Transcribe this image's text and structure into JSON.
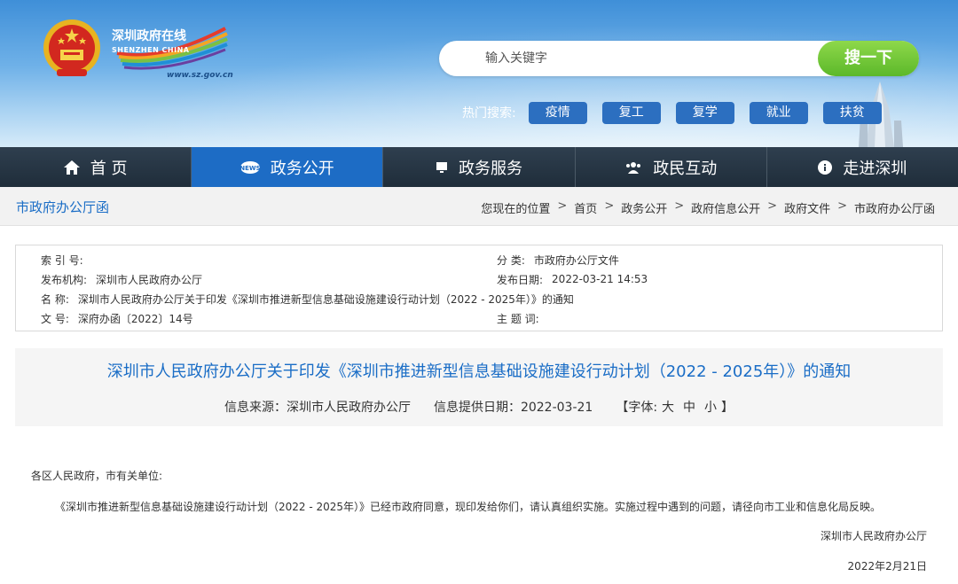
{
  "header": {
    "logo": {
      "cn": "深圳政府在线",
      "en": "SHENZHEN CHINA",
      "url": "www.sz.gov.cn"
    },
    "search": {
      "placeholder": "输入关键字",
      "button": "搜一下"
    },
    "hot_search": {
      "label": "热门搜索:",
      "tags": [
        "疫情",
        "复工",
        "复学",
        "就业",
        "扶贫"
      ]
    }
  },
  "nav": {
    "items": [
      {
        "label": "首 页",
        "icon": "home-icon"
      },
      {
        "label": "政务公开",
        "icon": "news-icon"
      },
      {
        "label": "政务服务",
        "icon": "monitor-icon"
      },
      {
        "label": "政民互动",
        "icon": "people-icon"
      },
      {
        "label": "走进深圳",
        "icon": "info-icon"
      }
    ],
    "active_index": 1
  },
  "section": {
    "title": "市政府办公厅函",
    "breadcrumb_label": "您现在的位置",
    "breadcrumb": [
      "首页",
      "政务公开",
      "政府信息公开",
      "政府文件",
      "市政府办公厅函"
    ],
    "separator": ">"
  },
  "meta": {
    "index_no": {
      "k": "索 引 号:",
      "v": ""
    },
    "category": {
      "k": "分 类:",
      "v": "市政府办公厅文件"
    },
    "issuer": {
      "k": "发布机构:",
      "v": "深圳市人民政府办公厅"
    },
    "date": {
      "k": "发布日期:",
      "v": "2022-03-21 14:53"
    },
    "name": {
      "k": "名 称:",
      "v": "深圳市人民政府办公厅关于印发《深圳市推进新型信息基础设施建设行动计划（2022 - 2025年）》的通知"
    },
    "doc_no": {
      "k": "文 号:",
      "v": "深府办函〔2022〕14号"
    },
    "subject": {
      "k": "主 题 词:",
      "v": ""
    }
  },
  "article": {
    "title": "深圳市人民政府办公厅关于印发《深圳市推进新型信息基础设施建设行动计划（2022 - 2025年）》的通知",
    "source": "信息来源：深圳市人民政府办公厅",
    "provided": "信息提供日期：2022-03-21",
    "font_label": "【字体:",
    "font_sizes": [
      "大",
      "中",
      "小"
    ],
    "font_close": "】",
    "salutation": "各区人民政府，市有关单位:",
    "paragraph": "《深圳市推进新型信息基础设施建设行动计划（2022 - 2025年）》已经市政府同意，现印发给你们，请认真组织实施。实施过程中遇到的问题，请径向市工业和信息化局反映。",
    "signature": "深圳市人民政府办公厅",
    "sign_date": "2022年2月21日"
  },
  "colors": {
    "nav_bg": "#263645",
    "nav_active": "#1d6cc5",
    "link_blue": "#1a6dc6",
    "search_btn": "#6cc238",
    "hot_tag": "#2c6fc0"
  }
}
